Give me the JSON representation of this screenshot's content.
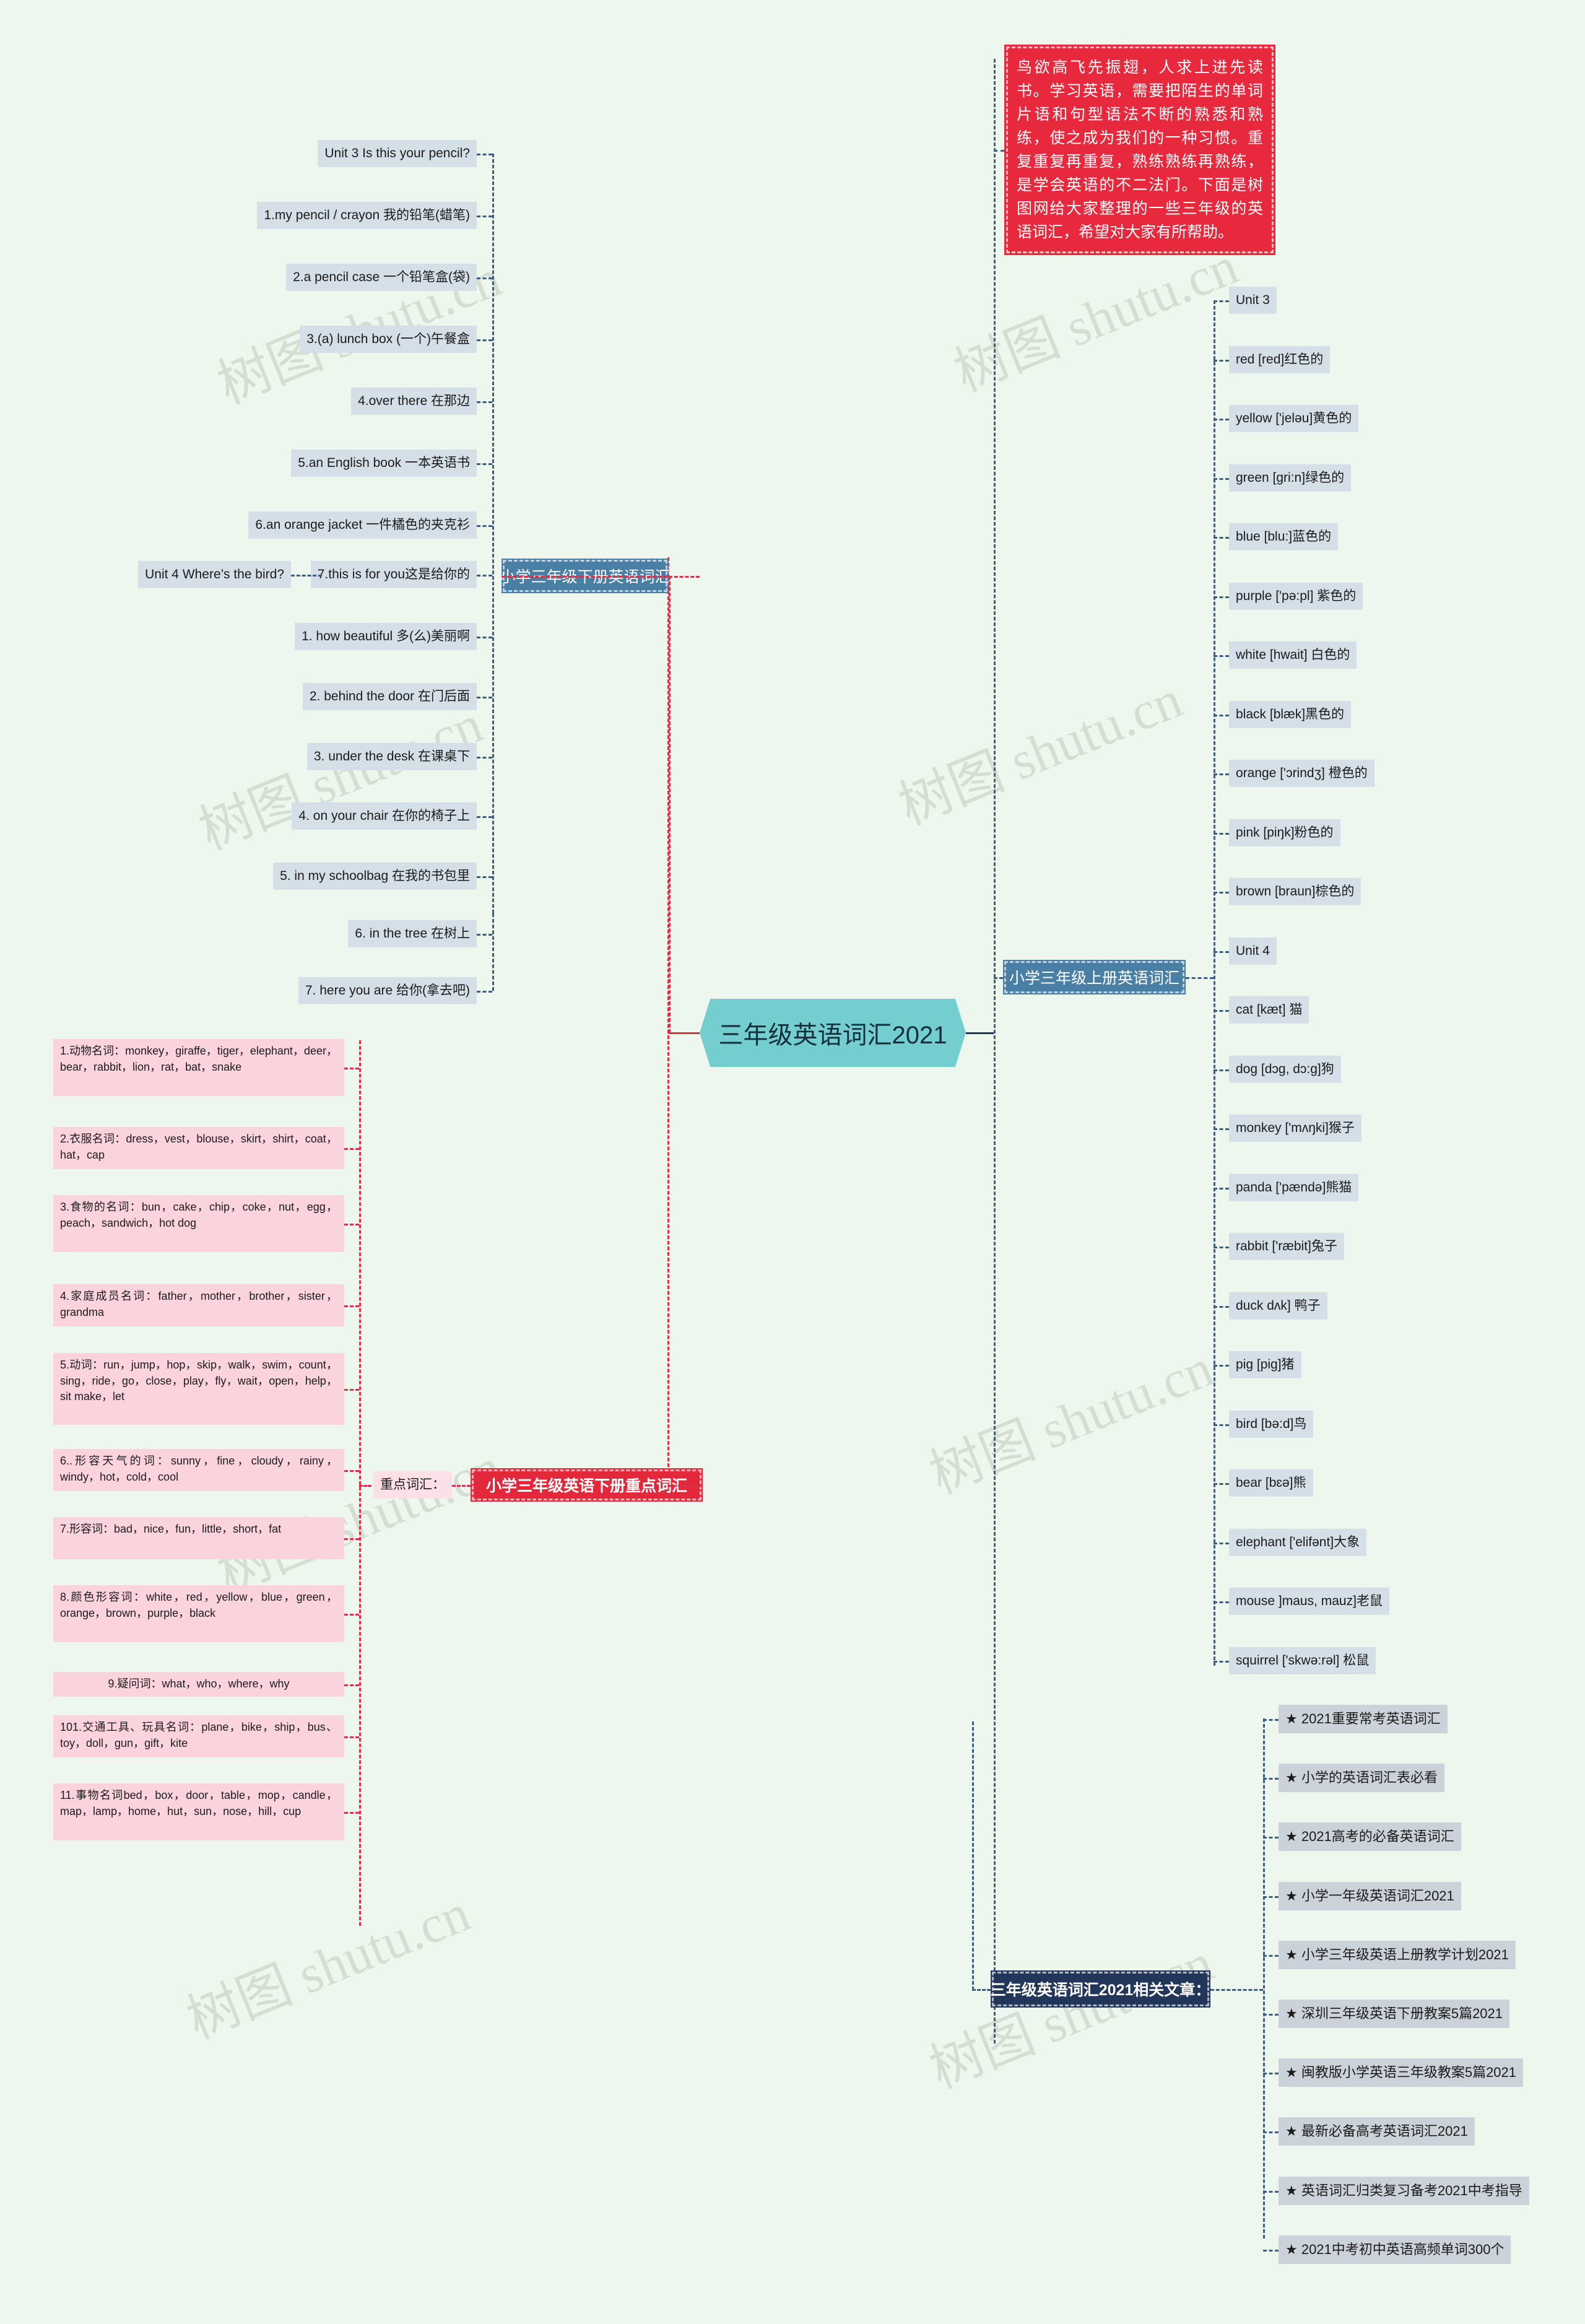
{
  "center": {
    "title": "三年级英语词汇2021"
  },
  "intro": {
    "text": "鸟欲高飞先振翅，人求上进先读书。学习英语，需要把陌生的单词片语和句型语法不断的熟悉和熟练，使之成为我们的一种习惯。重复重复再重复，熟练熟练再熟练，是学会英语的不二法门。下面是树图网给大家整理的一些三年级的英语词汇，希望对大家有所帮助。"
  },
  "colors": {
    "background": "#eef7ee",
    "chip": "#d5dfe8",
    "chip_pink": "#fbd3dc",
    "chip_gray": "#ccd2d9",
    "center": "#74cdce",
    "blue_box": "#4a7fa5",
    "navy_box": "#22365a",
    "red_box": "#e4283c",
    "connector_blue": "#3f5d7d",
    "connector_red": "#d6324a"
  },
  "branches": {
    "xia_ce": {
      "label": "小学三年级下册英语词汇",
      "unit3": {
        "title": "Unit 3 Is this your pencil?",
        "items": [
          "1.my pencil / crayon 我的铅笔(蜡笔)",
          "2.a pencil case 一个铅笔盒(袋)",
          "3.(a) lunch box (一个)午餐盒",
          "4.over there 在那边",
          "5.an English book 一本英语书",
          "6.an orange jacket 一件橘色的夹克衫",
          "7.this is for you这是给你的"
        ]
      },
      "unit4": {
        "title": "Unit 4 Where’s the bird?",
        "items": [
          "1. how beautiful 多(么)美丽啊",
          "2. behind the door 在门后面",
          "3. under the desk 在课桌下",
          "4. on your chair 在你的椅子上",
          "5. in my schoolbag 在我的书包里",
          "6. in the tree 在树上",
          "7. here you are 给你(拿去吧)"
        ]
      }
    },
    "zhongdian": {
      "label": "小学三年级英语下册重点词汇",
      "sub_label": "重点词汇：",
      "items": [
        "1.动物名词：monkey，giraffe，tiger，elephant，deer，bear，rabbit，lion，rat，bat，snake",
        "2.衣服名词：dress，vest，blouse，skirt，shirt，coat，hat，cap",
        "3.食物的名词：bun，cake，chip，coke，nut，egg，peach，sandwich，hot dog",
        "4.家庭成员名词：father，mother，brother，sister，grandma",
        "5.动词：run，jump，hop，skip，walk，swim，count，sing，ride，go，close，play，fly，wait，open，help，sit make，let",
        "6..形容天气的词：sunny，fine，cloudy，rainy，windy，hot，cold，cool",
        "7.形容词：bad，nice，fun，little，short，fat",
        "8.颜色形容词：white，red，yellow，blue，green，orange，brown，purple，black",
        "9.疑问词：what，who，where，why",
        "101.交通工具、玩具名词：plane，bike，ship，bus、toy，doll，gun，gift，kite",
        "11.事物名词bed，box，door，table，mop，candle，map，lamp，home，hut，sun，nose，hill，cup"
      ]
    },
    "shang_ce": {
      "label": "小学三年级上册英语词汇",
      "unit3": {
        "title": "Unit 3",
        "items": [
          "red [red]红色的",
          "yellow ['jeləu]黄色的",
          "green [gri:n]绿色的",
          "blue [blu:]蓝色的",
          "purple ['pə:pl] 紫色的",
          "white [hwait] 白色的",
          "black [blæk]黑色的",
          "orange ['ɔrindʒ] 橙色的",
          "pink [piŋk]粉色的",
          "brown [braun]棕色的"
        ]
      },
      "unit4": {
        "title": "Unit 4",
        "items": [
          "cat [kæt] 猫",
          "dog [dɔg, dɔ:g]狗",
          "monkey ['mʌŋki]猴子",
          "panda ['pændə]熊猫",
          "rabbit ['ræbit]兔子",
          "duck dʌk] 鸭子",
          "pig [pig]猪",
          "bird [bə:d]鸟",
          "bear [bɛə]熊",
          "elephant ['elifənt]大象",
          "mouse ]maus, mauz]老鼠",
          "squirrel ['skwə:rəl] 松鼠"
        ]
      }
    },
    "related": {
      "label": "三年级英语词汇2021相关文章：",
      "items": [
        "★ 2021重要常考英语词汇",
        "★ 小学的英语词汇表必看",
        "★ 2021高考的必备英语词汇",
        "★ 小学一年级英语词汇2021",
        "★ 小学三年级英语上册教学计划2021",
        "★ 深圳三年级英语下册教案5篇2021",
        "★ 闽教版小学英语三年级教案5篇2021",
        "★ 最新必备高考英语词汇2021",
        "★ 英语词汇归类复习备考2021中考指导",
        "★ 2021中考初中英语高频单词300个"
      ]
    }
  },
  "watermarks": [
    "树图 shutu.cn",
    "树图 shutu.cn",
    "树图 shutu.cn",
    "树图 shutu.cn",
    "树图 shutu.cn",
    "树图 shutu.cn"
  ]
}
